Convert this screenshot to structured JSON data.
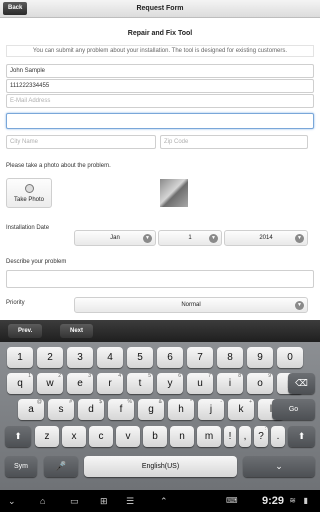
{
  "topbar": {
    "back_label": "Back",
    "title": "Request Form"
  },
  "form": {
    "heading": "Repair and Fix Tool",
    "intro": "You can submit any problem about your installation. The tool is designed for existing customers.",
    "name_value": "John Sample",
    "phone_value": "111222334455",
    "email_placeholder": "E-Mail Address",
    "address_value": "",
    "city_placeholder": "City Name",
    "zip_placeholder": "Zip Code",
    "photo_prompt": "Please take a photo about the problem.",
    "take_photo_label": "Take Photo",
    "installation_date_label": "Installation Date",
    "month_value": "Jan",
    "day_value": "1",
    "year_value": "2014",
    "describe_label": "Describe your problem",
    "priority_label": "Priority",
    "priority_value": "Normal"
  },
  "nav": {
    "prev_label": "Prev.",
    "next_label": "Next"
  },
  "keyboard": {
    "row1": [
      "1",
      "2",
      "3",
      "4",
      "5",
      "6",
      "7",
      "8",
      "9",
      "0"
    ],
    "row2": [
      "q",
      "w",
      "e",
      "r",
      "t",
      "y",
      "u",
      "i",
      "o",
      "p"
    ],
    "row2_sup": [
      "1",
      "2",
      "3",
      "4",
      "5",
      "6",
      "7",
      "8",
      "9",
      "0"
    ],
    "row3": [
      "a",
      "s",
      "d",
      "f",
      "g",
      "h",
      "j",
      "k",
      "l"
    ],
    "row3_sup": [
      "@",
      "#",
      "$",
      "%",
      "&",
      "*",
      "-",
      "+",
      "("
    ],
    "row4": [
      "z",
      "x",
      "c",
      "v",
      "b",
      "n",
      "m",
      "!",
      ",",
      "?",
      "."
    ],
    "row4_sup": [
      "",
      "",
      "",
      "",
      "",
      "",
      "",
      "",
      "",
      ":",
      ""
    ],
    "go_label": "Go",
    "sym_label": "Sym",
    "space_label": "English(US)"
  },
  "system": {
    "time": "9:29"
  },
  "colors": {
    "accent_focus": "#7aa7d9",
    "bar_dark": "#2a2a2a"
  }
}
